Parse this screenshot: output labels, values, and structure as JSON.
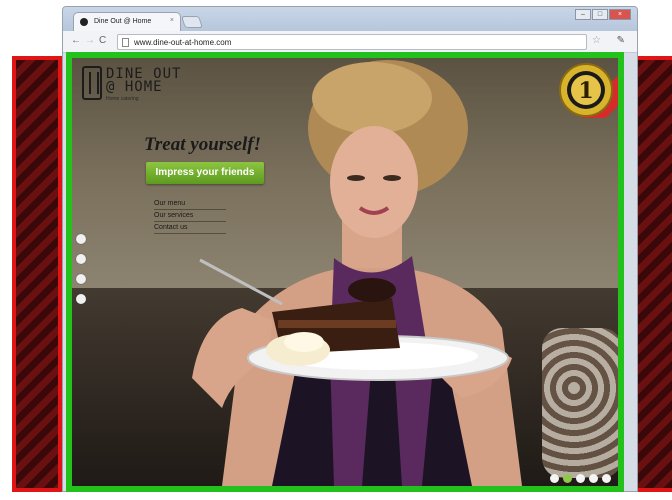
{
  "browser": {
    "tab_title": "Dine Out @ Home",
    "tab_close": "×",
    "url": "www.dine-out-at-home.com",
    "back_icon": "back-arrow-icon",
    "forward_icon": "forward-arrow-icon",
    "reload_icon": "reload-icon",
    "star_icon": "star-icon",
    "wrench_icon": "wrench-icon"
  },
  "site": {
    "logo": {
      "line1": "DINE OUT",
      "line2": "@ HOME",
      "tagline": "Home catering"
    },
    "headline": "Treat yourself!",
    "cta_label": "Impress your friends",
    "menu": [
      "Our menu",
      "Our services",
      "Contact us"
    ],
    "seal_number": "1",
    "side_dots": 4,
    "slider": {
      "count": 5,
      "active_index": 1
    }
  },
  "colors": {
    "frame_green": "#22c11c",
    "frame_red": "#e01616",
    "cta_green": "#6faf2a",
    "seal_gold": "#d8b32c"
  }
}
